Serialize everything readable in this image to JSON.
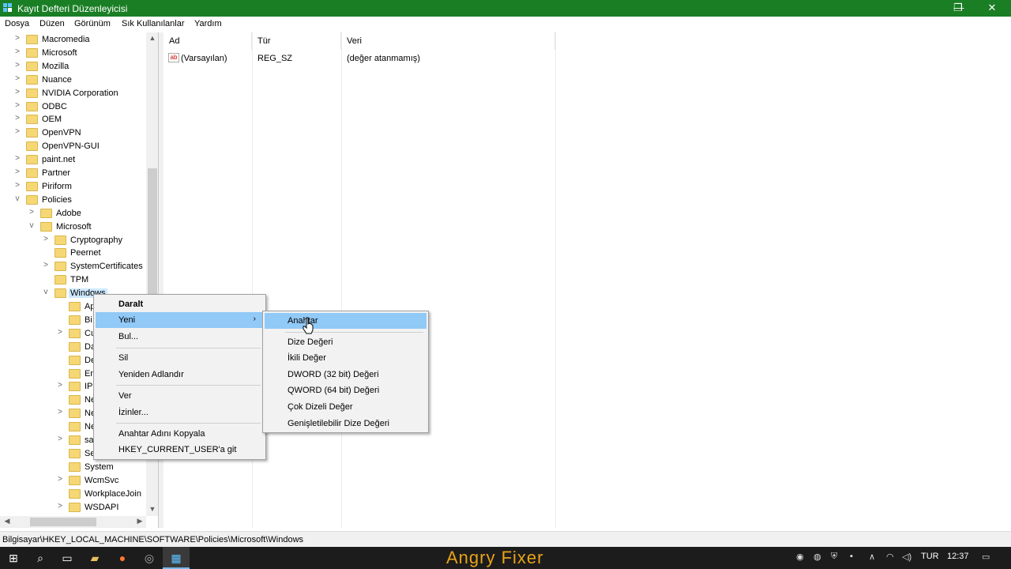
{
  "window": {
    "title": "Kayıt Defteri Düzenleyicisi",
    "minimize": "—",
    "restore": "❐",
    "close": "✕"
  },
  "menu": [
    "Dosya",
    "Düzen",
    "Görünüm",
    "Sık Kullanılanlar",
    "Yardım"
  ],
  "tree": [
    {
      "label": "Macromedia",
      "depth": 0,
      "exp": ">"
    },
    {
      "label": "Microsoft",
      "depth": 0,
      "exp": ">"
    },
    {
      "label": "Mozilla",
      "depth": 0,
      "exp": ">"
    },
    {
      "label": "Nuance",
      "depth": 0,
      "exp": ">"
    },
    {
      "label": "NVIDIA Corporation",
      "depth": 0,
      "exp": ">"
    },
    {
      "label": "ODBC",
      "depth": 0,
      "exp": ">"
    },
    {
      "label": "OEM",
      "depth": 0,
      "exp": ">"
    },
    {
      "label": "OpenVPN",
      "depth": 0,
      "exp": ">"
    },
    {
      "label": "OpenVPN-GUI",
      "depth": 0,
      "exp": ""
    },
    {
      "label": "paint.net",
      "depth": 0,
      "exp": ">"
    },
    {
      "label": "Partner",
      "depth": 0,
      "exp": ">"
    },
    {
      "label": "Piriform",
      "depth": 0,
      "exp": ">"
    },
    {
      "label": "Policies",
      "depth": 0,
      "exp": "v"
    },
    {
      "label": "Adobe",
      "depth": 1,
      "exp": ">"
    },
    {
      "label": "Microsoft",
      "depth": 1,
      "exp": "v"
    },
    {
      "label": "Cryptography",
      "depth": 2,
      "exp": ">"
    },
    {
      "label": "Peernet",
      "depth": 2,
      "exp": ""
    },
    {
      "label": "SystemCertificates",
      "depth": 2,
      "exp": ">"
    },
    {
      "label": "TPM",
      "depth": 2,
      "exp": ""
    },
    {
      "label": "Windows",
      "depth": 2,
      "exp": "v",
      "selected": true
    },
    {
      "label": "Ap",
      "depth": 3,
      "exp": ""
    },
    {
      "label": "Bi",
      "depth": 3,
      "exp": ""
    },
    {
      "label": "Cu",
      "depth": 3,
      "exp": ">"
    },
    {
      "label": "Da",
      "depth": 3,
      "exp": ""
    },
    {
      "label": "De",
      "depth": 3,
      "exp": ""
    },
    {
      "label": "En",
      "depth": 3,
      "exp": ""
    },
    {
      "label": "IP",
      "depth": 3,
      "exp": ">"
    },
    {
      "label": "Ne",
      "depth": 3,
      "exp": ""
    },
    {
      "label": "Ne",
      "depth": 3,
      "exp": ">"
    },
    {
      "label": "Ne",
      "depth": 3,
      "exp": ""
    },
    {
      "label": "sa",
      "depth": 3,
      "exp": ">"
    },
    {
      "label": "Se",
      "depth": 3,
      "exp": ""
    },
    {
      "label": "System",
      "depth": 3,
      "exp": ""
    },
    {
      "label": "WcmSvc",
      "depth": 3,
      "exp": ">"
    },
    {
      "label": "WorkplaceJoin",
      "depth": 3,
      "exp": ""
    },
    {
      "label": "WSDAPI",
      "depth": 3,
      "exp": ">"
    }
  ],
  "list": {
    "headers": [
      "Ad",
      "Tür",
      "Veri"
    ],
    "rows": [
      {
        "name": "(Varsayılan)",
        "type": "REG_SZ",
        "data": "(değer atanmamış)",
        "icon": "ab"
      }
    ]
  },
  "context_menu": {
    "items": [
      "Daralt",
      "Yeni",
      "Bul...",
      "Sil",
      "Yeniden Adlandır",
      "Ver",
      "İzinler...",
      "Anahtar Adını Kopyala",
      "HKEY_CURRENT_USER'a git"
    ],
    "submenu_arrow": "›"
  },
  "submenu": {
    "items": [
      "Anahtar",
      "Dize Değeri",
      "İkili Değer",
      "DWORD (32 bit) Değeri",
      "QWORD (64 bit) Değeri",
      "Çok Dizeli Değer",
      "Genişletilebilir Dize Değeri"
    ]
  },
  "status": "Bilgisayar\\HKEY_LOCAL_MACHINE\\SOFTWARE\\Policies\\Microsoft\\Windows",
  "taskbar": {
    "watermark": "Angry Fixer",
    "lang": "TUR",
    "time": "12:37",
    "accent": "#1a7e25"
  }
}
